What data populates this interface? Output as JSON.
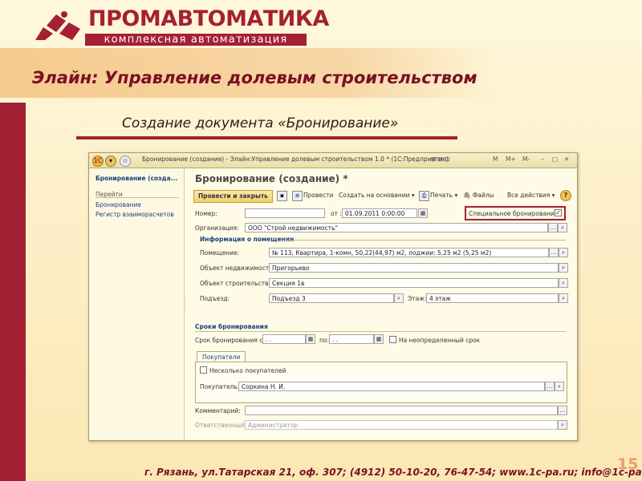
{
  "logo": {
    "word_part1": "ПРОМ",
    "word_part2": "АВТОМАТИКА",
    "tagline": "комплексная автоматизация"
  },
  "slide": {
    "title": "Элайн: Управление долевым строительством",
    "subtitle": "Создание документа «Бронирование»",
    "footer": "г. Рязань, ул.Татарская 21, оф. 307; (4912) 50-10-20, 76-47-54; www.1c-pa.ru; info@1c-pa.ru",
    "page_number": "15"
  },
  "colors": {
    "brand": "#a32035",
    "link": "#1c3f7c",
    "band": "#f6ca8e"
  },
  "window": {
    "title": "Бронирование (создание) - Элайн:Управление долевым строительством 1.0 * (1С:Предприятие)",
    "title_controls": [
      "M",
      "M+",
      "M-"
    ],
    "sidebar": {
      "header": "Бронирование (созда...",
      "goto_label": "Перейти",
      "links": [
        "Бронирование",
        "Регистр взаиморасчетов"
      ]
    },
    "document": {
      "title": "Бронирование (создание) *",
      "toolbar": {
        "post_close": "Провести и закрыть",
        "post": "Провести",
        "create_based": "Создать на основании",
        "print": "Печать",
        "files": "Файлы",
        "all_actions": "Все действия",
        "help": "?"
      },
      "number_label": "Номер:",
      "number_value": "",
      "date_label": "от :",
      "date_value": "01.09.2011  0:00:00",
      "special_label": "Специальное бронирование:",
      "special_checked": true,
      "org_label": "Организация:",
      "org_value": "ООО \"Строй недвижимость\"",
      "premises": {
        "title": "Информация о помещении",
        "room_label": "Помещение:",
        "room_value": "№ 113, Квартира, 1-комн, 50,22(44,97)  м2, лоджии: 5,25 м2  (5,25 м2)",
        "estate_label": "Объект недвижимости:",
        "estate_value": "Пригорьево",
        "construction_label": "Объект строительства:",
        "construction_value": "Секция 1в",
        "entrance_label": "Подъезд:",
        "entrance_value": "Подъезд 3",
        "floor_label": "Этаж:",
        "floor_value": "4 этаж"
      },
      "period": {
        "title": "Сроки бронирования",
        "from_label": "Срок бронирования с:",
        "from_value": " .  .",
        "to_label": "по:",
        "to_value": " .  .",
        "indefinite_label": "На неопределенный срок",
        "indefinite_checked": false
      },
      "buyers": {
        "tab_label": "Покупатели",
        "multiple_label": "Несколько покупателей",
        "multiple_checked": false,
        "buyer_label": "Покупатель:",
        "buyer_value": "Соркина Н. И."
      },
      "comment_label": "Комментарий:",
      "comment_value": "",
      "responsible_label": "Ответственный:",
      "responsible_value": "Администратор"
    }
  }
}
